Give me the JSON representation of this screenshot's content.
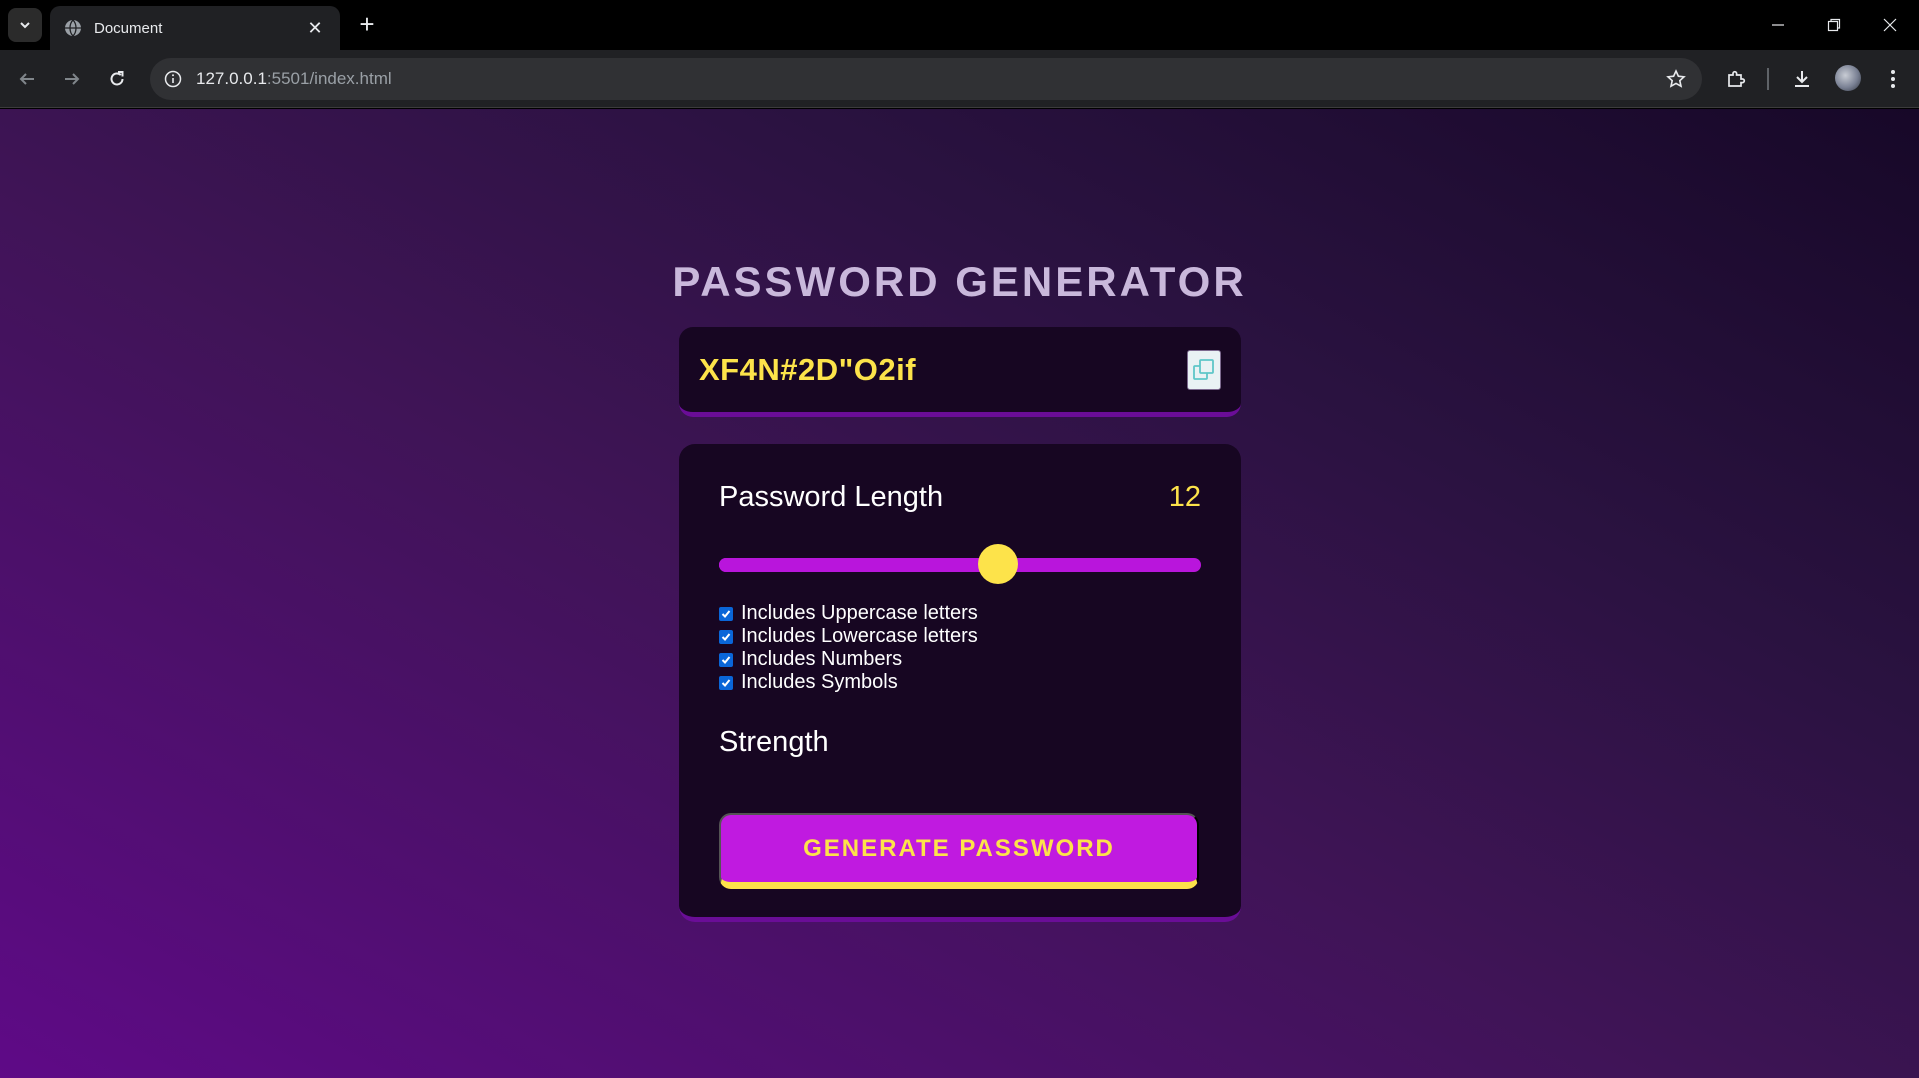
{
  "browser": {
    "tab_title": "Document",
    "url_host": "127.0.0.1",
    "url_path": ":5501/index.html"
  },
  "app": {
    "title": "PASSWORD GENERATOR",
    "password": "XF4N#2D\"O2if",
    "length_label": "Password Length",
    "length_value": "12",
    "slider": {
      "min": 1,
      "max": 20,
      "value": 12
    },
    "options": [
      {
        "label": "Includes Uppercase letters",
        "checked": true
      },
      {
        "label": "Includes Lowercase letters",
        "checked": true
      },
      {
        "label": "Includes Numbers",
        "checked": true
      },
      {
        "label": "Includes Symbols",
        "checked": true
      }
    ],
    "strength_label": "Strength",
    "generate_label": "GENERATE PASSWORD"
  },
  "colors": {
    "accent_yellow": "#fde34a",
    "accent_purple": "#c01ae0",
    "card_bg": "#170622"
  }
}
